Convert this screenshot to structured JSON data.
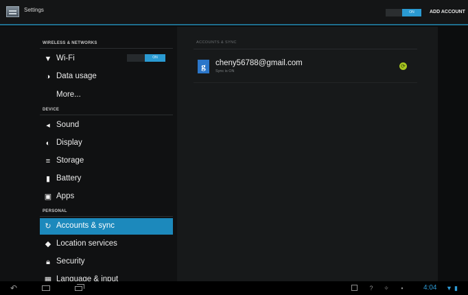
{
  "app": {
    "title": "Settings"
  },
  "actionbar": {
    "toggle_state": "ON",
    "add_account_label": "ADD ACCOUNT"
  },
  "sidebar": {
    "sections": [
      {
        "header": "WIRELESS & NETWORKS"
      },
      {
        "header": "DEVICE"
      },
      {
        "header": "PERSONAL"
      }
    ],
    "items": [
      {
        "label": "Wi-Fi",
        "icon": "wifi-icon",
        "toggle": "ON"
      },
      {
        "label": "Data usage",
        "icon": "data-usage-icon"
      },
      {
        "label": "More..."
      },
      {
        "label": "Sound",
        "icon": "sound-icon"
      },
      {
        "label": "Display",
        "icon": "display-icon"
      },
      {
        "label": "Storage",
        "icon": "storage-icon"
      },
      {
        "label": "Battery",
        "icon": "battery-icon"
      },
      {
        "label": "Apps",
        "icon": "apps-icon"
      },
      {
        "label": "Accounts & sync",
        "icon": "sync-icon",
        "selected": true
      },
      {
        "label": "Location services",
        "icon": "location-icon"
      },
      {
        "label": "Security",
        "icon": "lock-icon"
      },
      {
        "label": "Language & input",
        "icon": "language-icon"
      }
    ]
  },
  "accounts": {
    "header": "ACCOUNTS & SYNC",
    "items": [
      {
        "email": "cheny56788@gmail.com",
        "status": "Sync is ON",
        "icon": "google-icon"
      }
    ]
  },
  "statusbar": {
    "time": "4:04"
  },
  "colors": {
    "accent": "#1c89bc",
    "toggle": "#2a9ad2",
    "sync_ok": "#a8c720"
  }
}
